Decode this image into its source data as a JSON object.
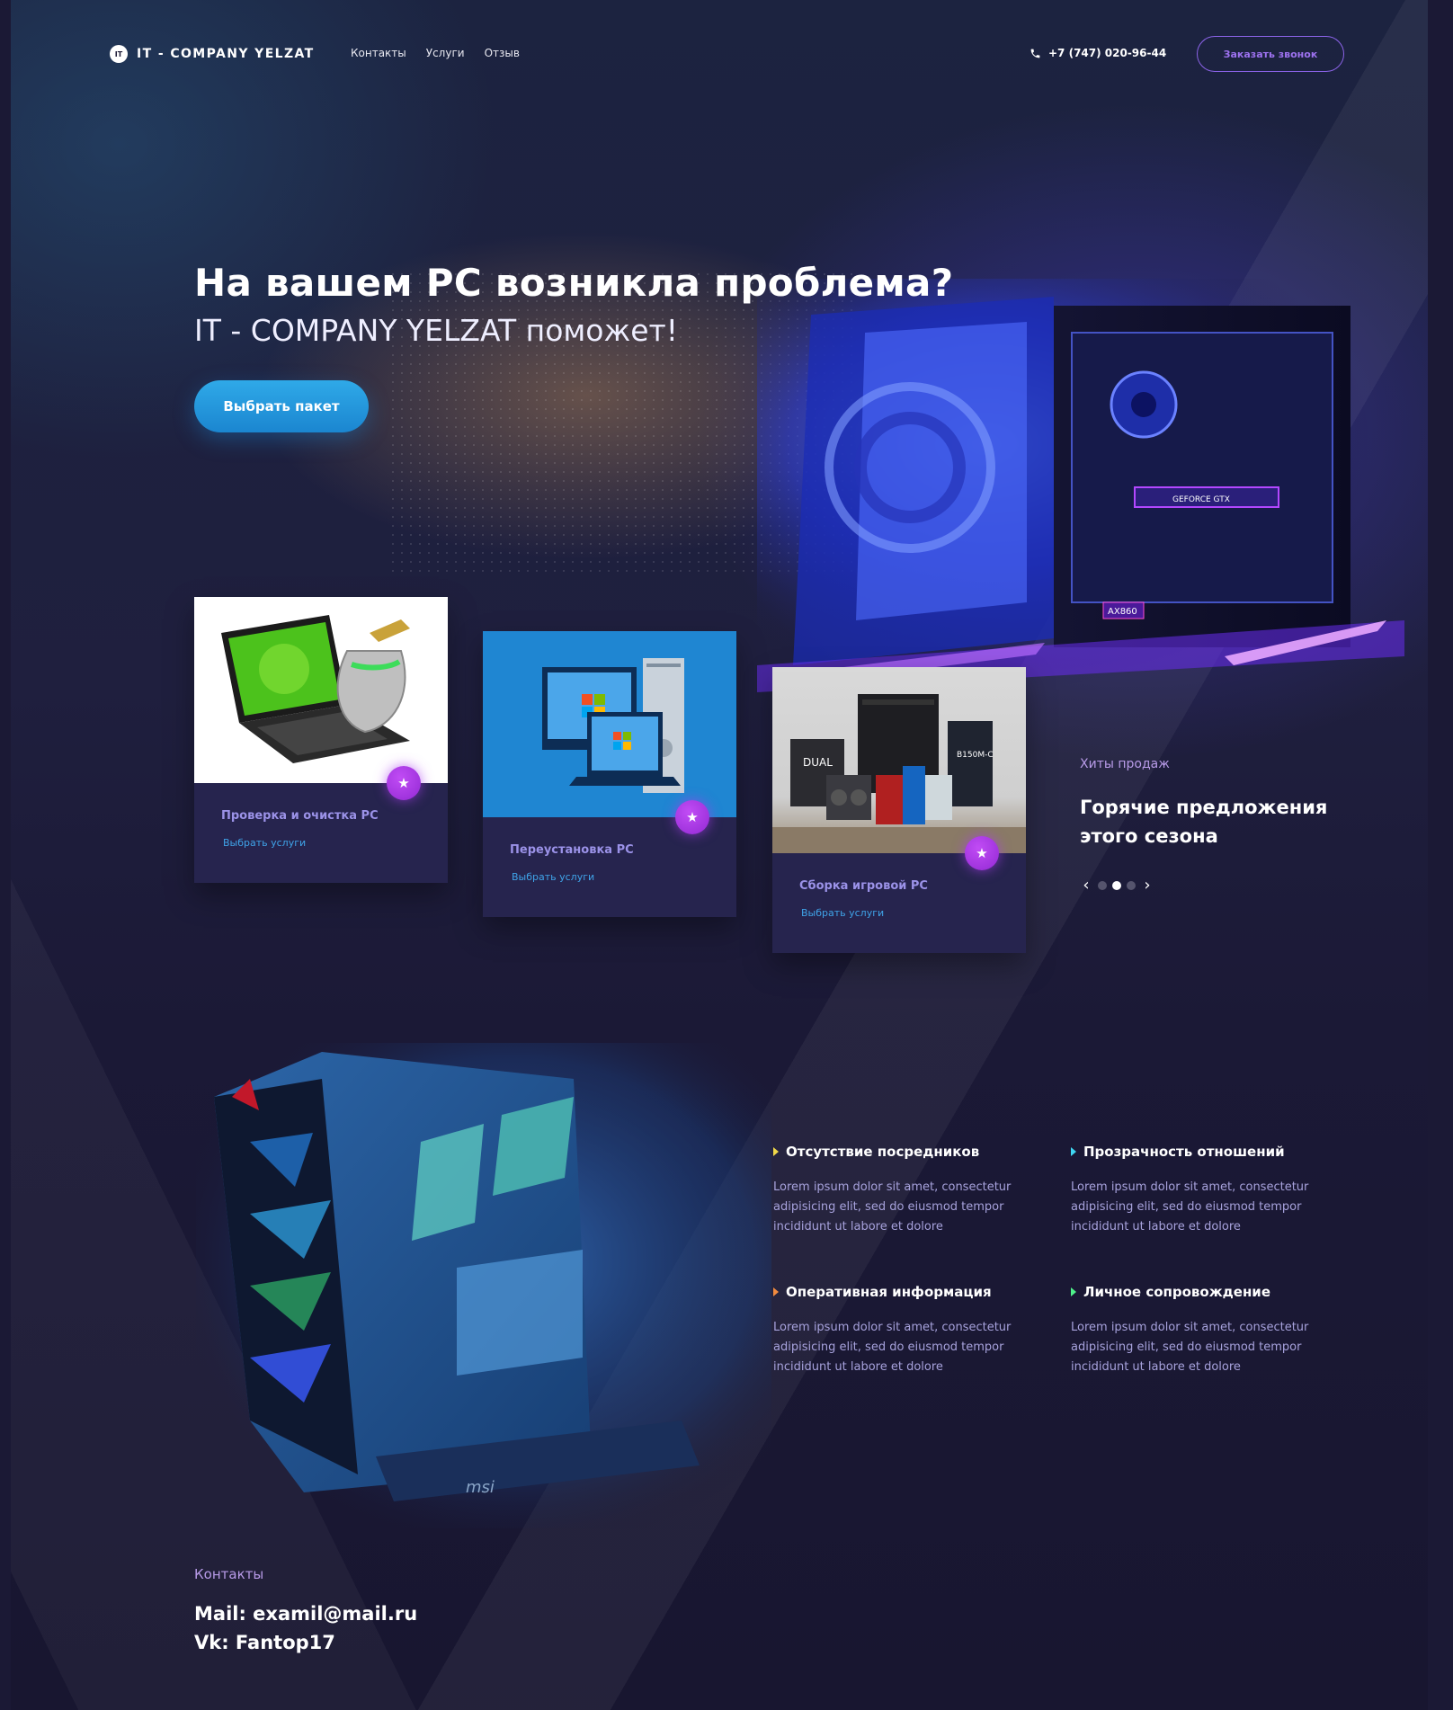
{
  "header": {
    "logo_badge": "IT",
    "logo_text": "IT - COMPANY YELZAT",
    "nav": [
      "Контакты",
      "Услуги",
      "Отзыв"
    ],
    "phone": "+7 (747) 020-96-44",
    "callback_label": "Заказать звонок"
  },
  "hero": {
    "title": "На вашем PC возникла проблема?",
    "subtitle": "IT - COMPANY YELZAT поможет!",
    "cta_label": "Выбрать пакет"
  },
  "cards": [
    {
      "title": "Проверка и очистка PC",
      "link": "Выбрать услуги",
      "icon": "star-icon"
    },
    {
      "title": "Переустановка PC",
      "link": "Выбрать услуги",
      "icon": "star-icon"
    },
    {
      "title": "Сборка игровой PC",
      "link": "Выбрать услуги",
      "icon": "star-icon"
    }
  ],
  "hits": {
    "label": "Хиты продаж",
    "title_line1": "Горячие предложения",
    "title_line2": "этого сезона",
    "slide_count": 3,
    "active_slide": 2
  },
  "features": [
    {
      "title": "Отсутствие посредников",
      "text": "Lorem ipsum dolor sit amet, consectetur adipisicing elit, sed do eiusmod tempor incididunt ut labore et dolore",
      "marker_color": "#f0d84a"
    },
    {
      "title": "Прозрачность отношений",
      "text": "Lorem ipsum dolor sit amet, consectetur adipisicing elit, sed do eiusmod tempor incididunt ut labore et dolore",
      "marker_color": "#3fd7f2"
    },
    {
      "title": "Оперативная информация",
      "text": "Lorem ipsum dolor sit amet, consectetur adipisicing elit, sed do eiusmod tempor incididunt ut labore et dolore",
      "marker_color": "#f28b3f"
    },
    {
      "title": "Личное сопровождение",
      "text": "Lorem ipsum dolor sit amet, consectetur adipisicing elit, sed do eiusmod tempor incididunt ut labore et dolore",
      "marker_color": "#4ef28a"
    }
  ],
  "contacts": {
    "label": "Контакты",
    "mail": "Mail: examil@mail.ru",
    "vk": "Vk: Fantop17"
  },
  "colors": {
    "background": "#1b1935",
    "accent_blue": "#2fa9e8",
    "accent_purple": "#9d72f0",
    "card_bg": "#26244e"
  }
}
